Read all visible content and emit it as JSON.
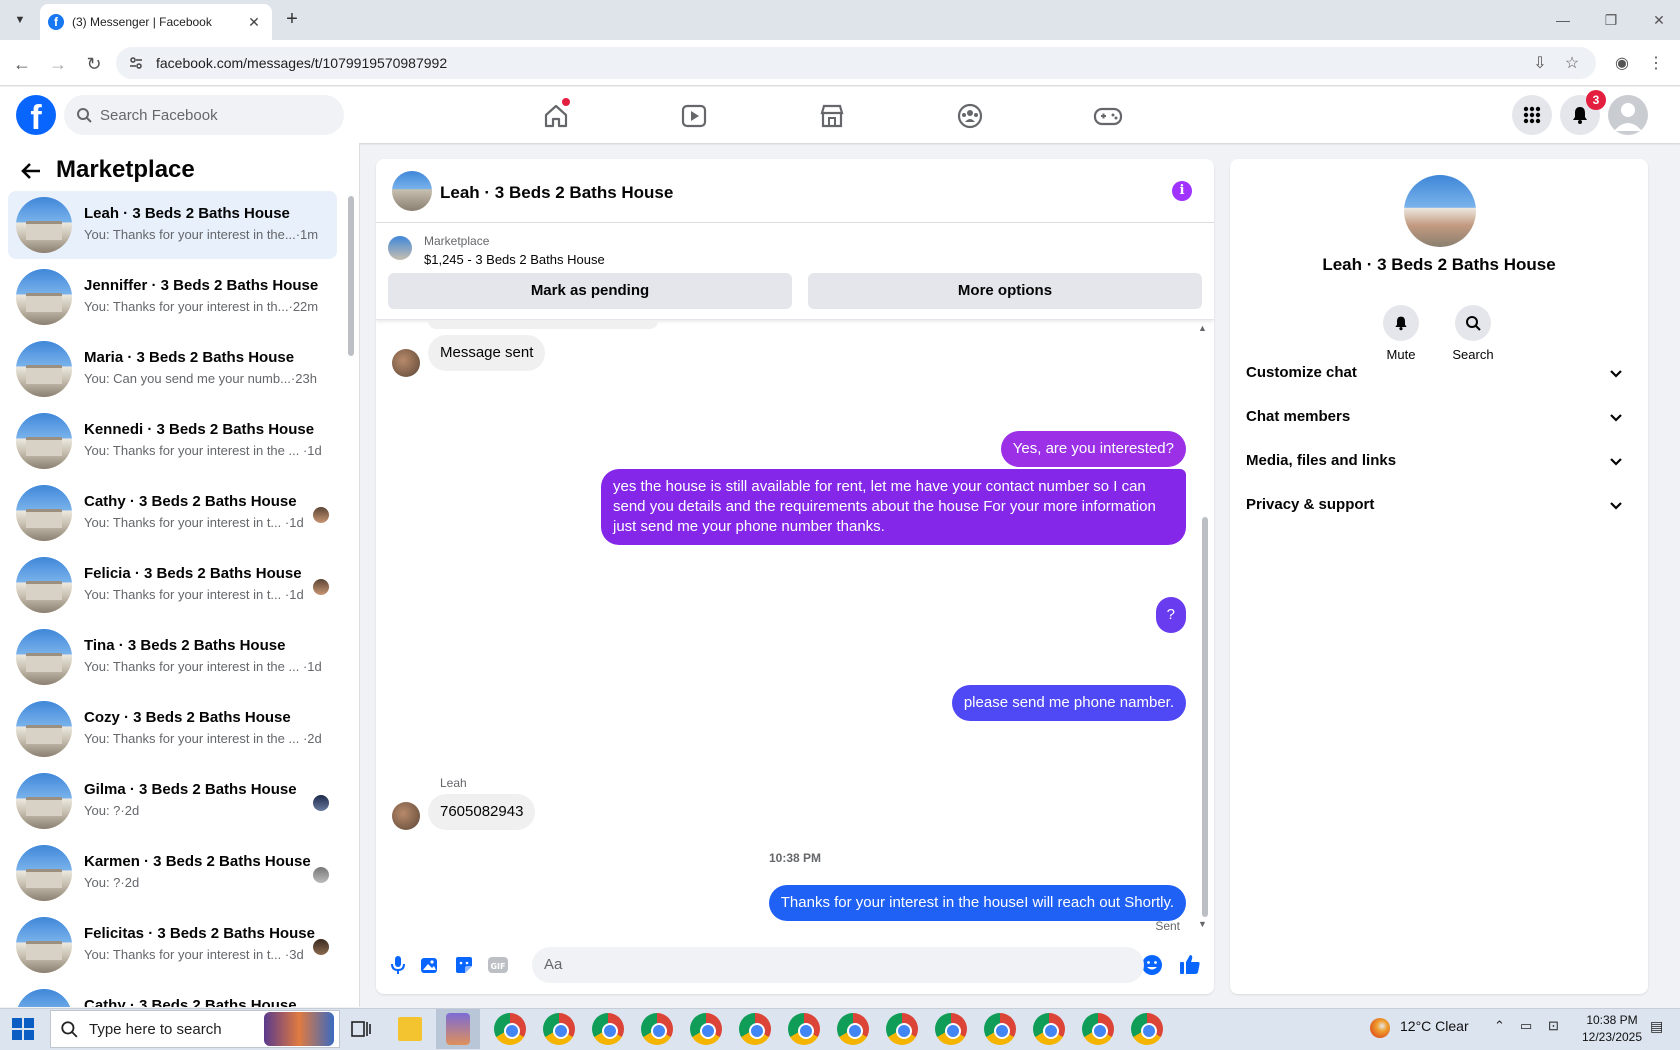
{
  "browser": {
    "tab_title": "(3) Messenger | Facebook",
    "url": "facebook.com/messages/t/1079919570987992",
    "new_tab": "+",
    "close_tab": "✕"
  },
  "header": {
    "search_placeholder": "Search Facebook",
    "notifications_count": "3"
  },
  "sidebar": {
    "title": "Marketplace",
    "conversations": [
      {
        "name": "Leah · 3 Beds 2 Baths House",
        "snippet": "You: Thanks for your interest in the...·1m"
      },
      {
        "name": "Jenniffer · 3 Beds 2 Baths House",
        "snippet": "You: Thanks for your interest in th...·22m"
      },
      {
        "name": "Maria · 3 Beds 2 Baths House",
        "snippet": "You: Can you send me your numb...·23h"
      },
      {
        "name": "Kennedi · 3 Beds 2 Baths House",
        "snippet": "You: Thanks for your interest in the ... ·1d"
      },
      {
        "name": "Cathy · 3 Beds 2 Baths House",
        "snippet": "You: Thanks for your interest in t... ·1d"
      },
      {
        "name": "Felicia · 3 Beds 2 Baths House",
        "snippet": "You: Thanks for your interest in t... ·1d"
      },
      {
        "name": "Tina · 3 Beds 2 Baths House",
        "snippet": "You: Thanks for your interest in the ... ·1d"
      },
      {
        "name": "Cozy · 3 Beds 2 Baths House",
        "snippet": "You: Thanks for your interest in the ... ·2d"
      },
      {
        "name": "Gilma · 3 Beds 2 Baths House",
        "snippet": "You: ?·2d"
      },
      {
        "name": "Karmen · 3 Beds 2 Baths House",
        "snippet": "You: ?·2d"
      },
      {
        "name": "Felicitas · 3 Beds 2 Baths House",
        "snippet": "You: Thanks for your interest in t... ·3d"
      },
      {
        "name": "Cathy · 3 Beds 2 Baths House",
        "snippet": ""
      }
    ]
  },
  "chat": {
    "title": "Leah · 3 Beds 2 Baths House",
    "marketplace_label": "Marketplace",
    "listing": "$1,245 - 3 Beds 2 Baths House",
    "mark_pending": "Mark as pending",
    "more_options": "More options",
    "messages": {
      "m1": "Message sent",
      "m2": "Yes, are you interested?",
      "m3": "yes the house is still available for rent, let me have your contact number so I can send you details and the requirements about the house For  your  more  information  just  send  me   your  phone  number thanks.",
      "m4": "?",
      "m5": "please send me phone nambe​r.",
      "sender_name": "Leah",
      "m6": "7605082943",
      "timestamp": "10:38 PM",
      "m7": "Thanks for your interest in the houseI will reach out Shortly.",
      "status": "Sent"
    },
    "composer_placeholder": "Aa"
  },
  "details": {
    "name": "Leah · 3 Beds 2 Baths House",
    "mute": "Mute",
    "search": "Search",
    "sections": [
      "Customize chat",
      "Chat members",
      "Media, files and links",
      "Privacy & support"
    ]
  },
  "taskbar": {
    "search_placeholder": "Type here to search",
    "weather": "12°C  Clear",
    "time": "10:38 PM",
    "date": "12/23/2025"
  },
  "colors": {
    "fb_blue": "#0866ff",
    "purple_bubble": "#8a2be2",
    "blue_bubble": "#2a5cff"
  }
}
